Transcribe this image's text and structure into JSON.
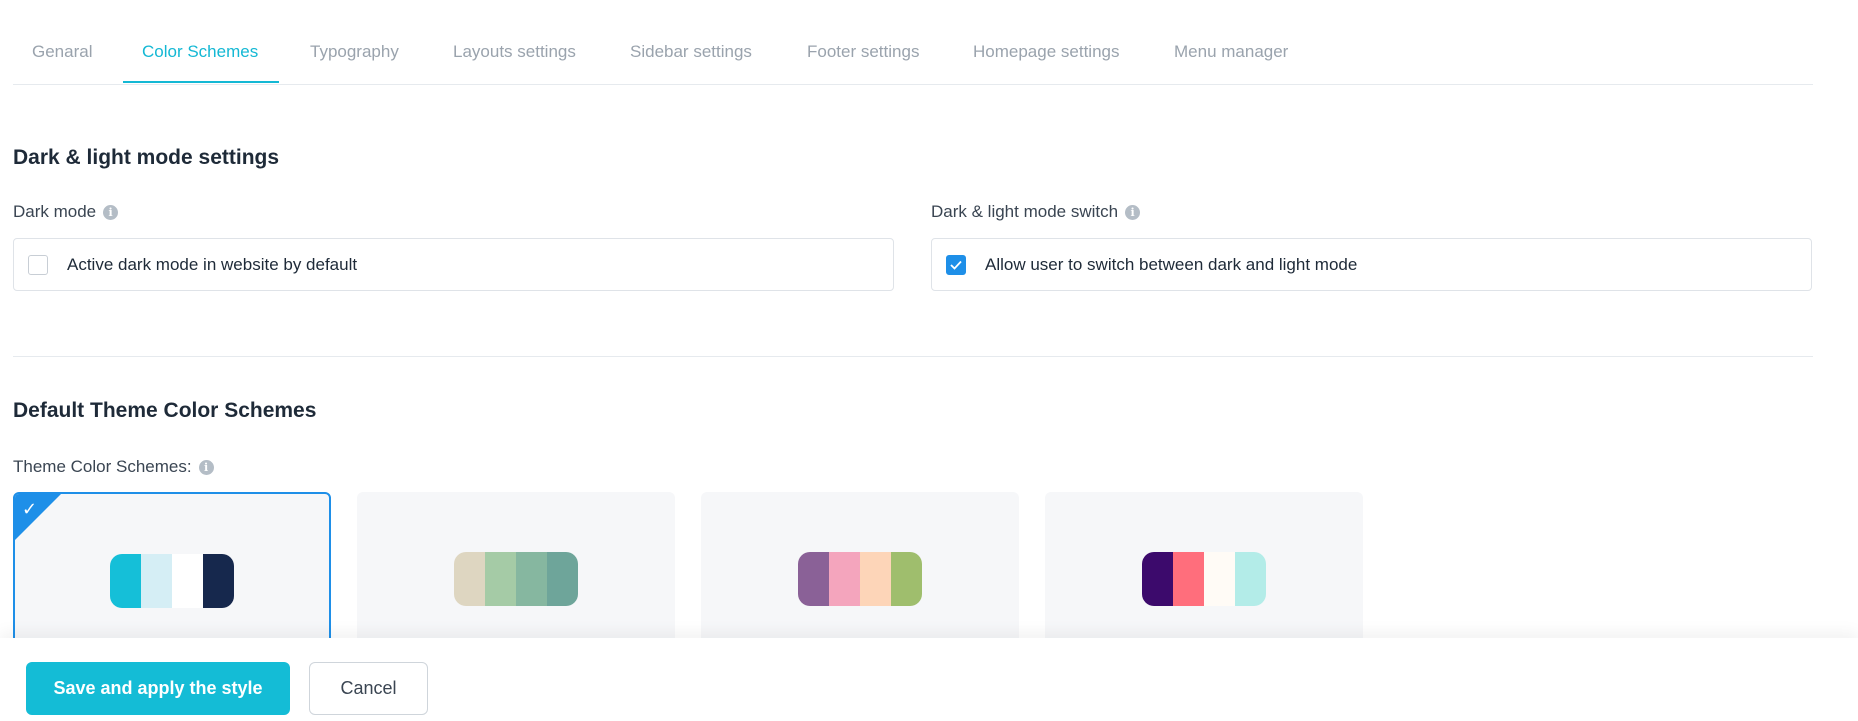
{
  "tabs": [
    {
      "label": "Genaral"
    },
    {
      "label": "Color Schemes"
    },
    {
      "label": "Typography"
    },
    {
      "label": "Layouts settings"
    },
    {
      "label": "Sidebar settings"
    },
    {
      "label": "Footer settings"
    },
    {
      "label": "Homepage settings"
    },
    {
      "label": "Menu manager"
    }
  ],
  "active_tab": "Color Schemes",
  "dark_light": {
    "title": "Dark & light mode settings",
    "dark_mode": {
      "label": "Dark mode",
      "option_text": "Active dark mode in website by default",
      "checked": false
    },
    "mode_switch": {
      "label": "Dark & light mode switch",
      "option_text": "Allow user to switch between dark and light mode",
      "checked": true
    }
  },
  "color_schemes": {
    "title": "Default Theme Color Schemes",
    "label": "Theme Color Schemes:",
    "selected_index": 0,
    "schemes": [
      {
        "colors": [
          "#15bfd8",
          "#d5eef5",
          "#ffffff",
          "#16284d"
        ]
      },
      {
        "colors": [
          "#ded6c1",
          "#a5cba6",
          "#86b7a0",
          "#6ea59a"
        ]
      },
      {
        "colors": [
          "#8a6197",
          "#f4a5bd",
          "#fdd5b8",
          "#9fbe6d"
        ]
      },
      {
        "colors": [
          "#3c0a6c",
          "#ff6e7c",
          "#fffbf6",
          "#b3ece8"
        ]
      }
    ]
  },
  "footer": {
    "save_label": "Save and apply the style",
    "cancel_label": "Cancel"
  },
  "colors": {
    "accent": "#14bcd6",
    "checkbox_blue": "#1e8fe8"
  }
}
